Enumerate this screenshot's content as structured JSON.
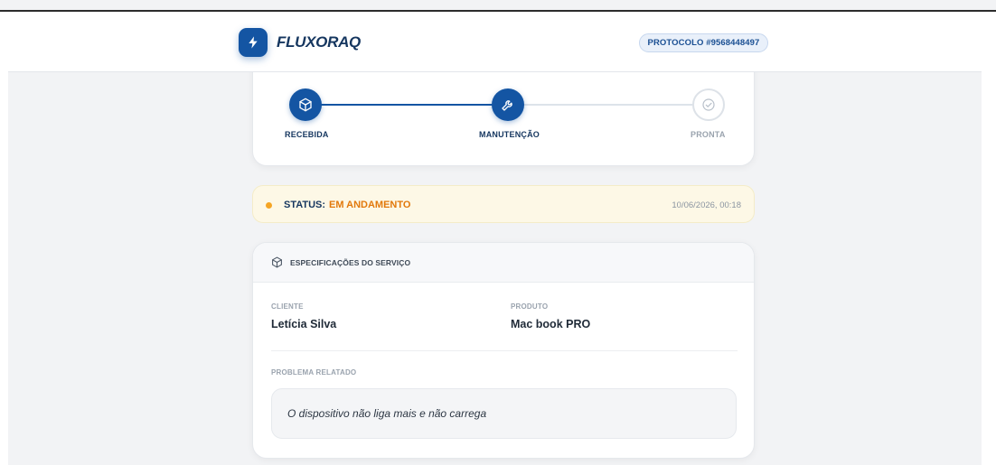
{
  "header": {
    "brand": "FLUXORAQ",
    "logo_icon": "lightning-icon",
    "protocol": "PROTOCOLO #9568448497"
  },
  "progress": {
    "steps": [
      {
        "label": "RECEBIDA",
        "icon": "box-icon",
        "state": "done"
      },
      {
        "label": "MANUTENÇÃO",
        "icon": "wrench-icon",
        "state": "done"
      },
      {
        "label": "PRONTA",
        "icon": "check-circle-icon",
        "state": "pending"
      }
    ]
  },
  "status": {
    "label": "STATUS:",
    "value": "EM ANDAMENTO",
    "timestamp": "10/06/2026, 00:18",
    "dot_color": "#f5a524",
    "value_color": "#e2790c"
  },
  "spec": {
    "title": "ESPECIFICAÇÕES DO SERVIÇO",
    "icon": "box-icon",
    "client_label": "CLIENTE",
    "client_value": "Letícia Silva",
    "product_label": "PRODUTO",
    "product_value": "Mac book PRO",
    "problem_label": "PROBLEMA RELATADO",
    "problem_value": "O dispositivo não liga mais e não carrega"
  },
  "colors": {
    "brand_blue": "#1455a3",
    "navy_text": "#15365f",
    "background": "#f2f3f5"
  }
}
